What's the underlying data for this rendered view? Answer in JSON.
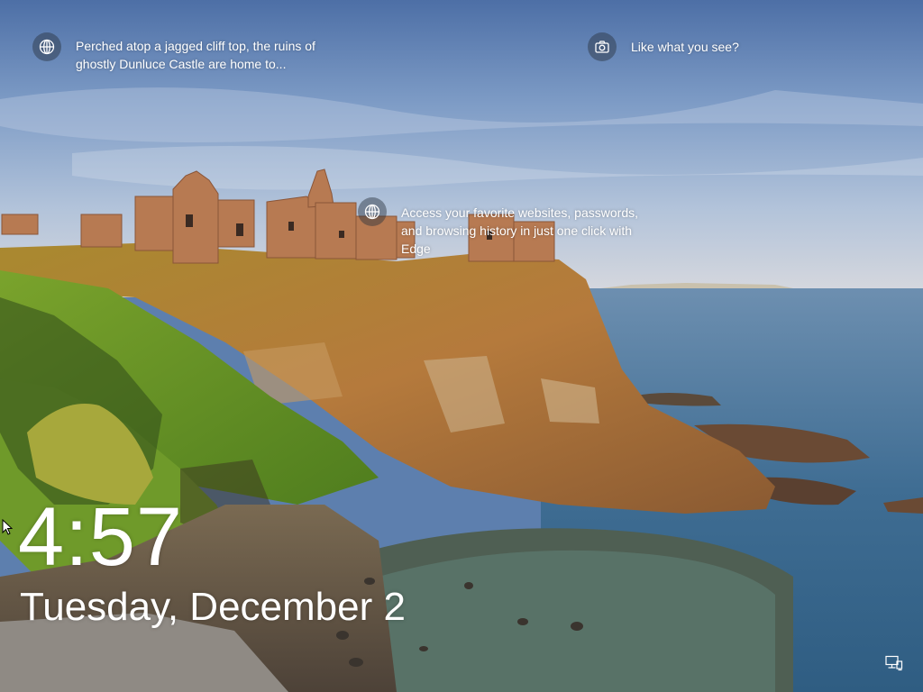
{
  "lock_screen": {
    "spotlight": {
      "castle_caption": "Perched atop a jagged cliff top, the ruins of ghostly Dunluce Castle are home to...",
      "castle_icon": "globe-icon",
      "feedback_label": "Like what you see?",
      "feedback_icon": "camera-icon",
      "edge_promo": "Access your favorite websites, passwords, and browsing history in just one click with Edge",
      "edge_icon": "globe-icon"
    },
    "clock": {
      "time": "4:57",
      "date": "Tuesday, December 2"
    },
    "status": {
      "network_icon": "network-icon"
    }
  }
}
